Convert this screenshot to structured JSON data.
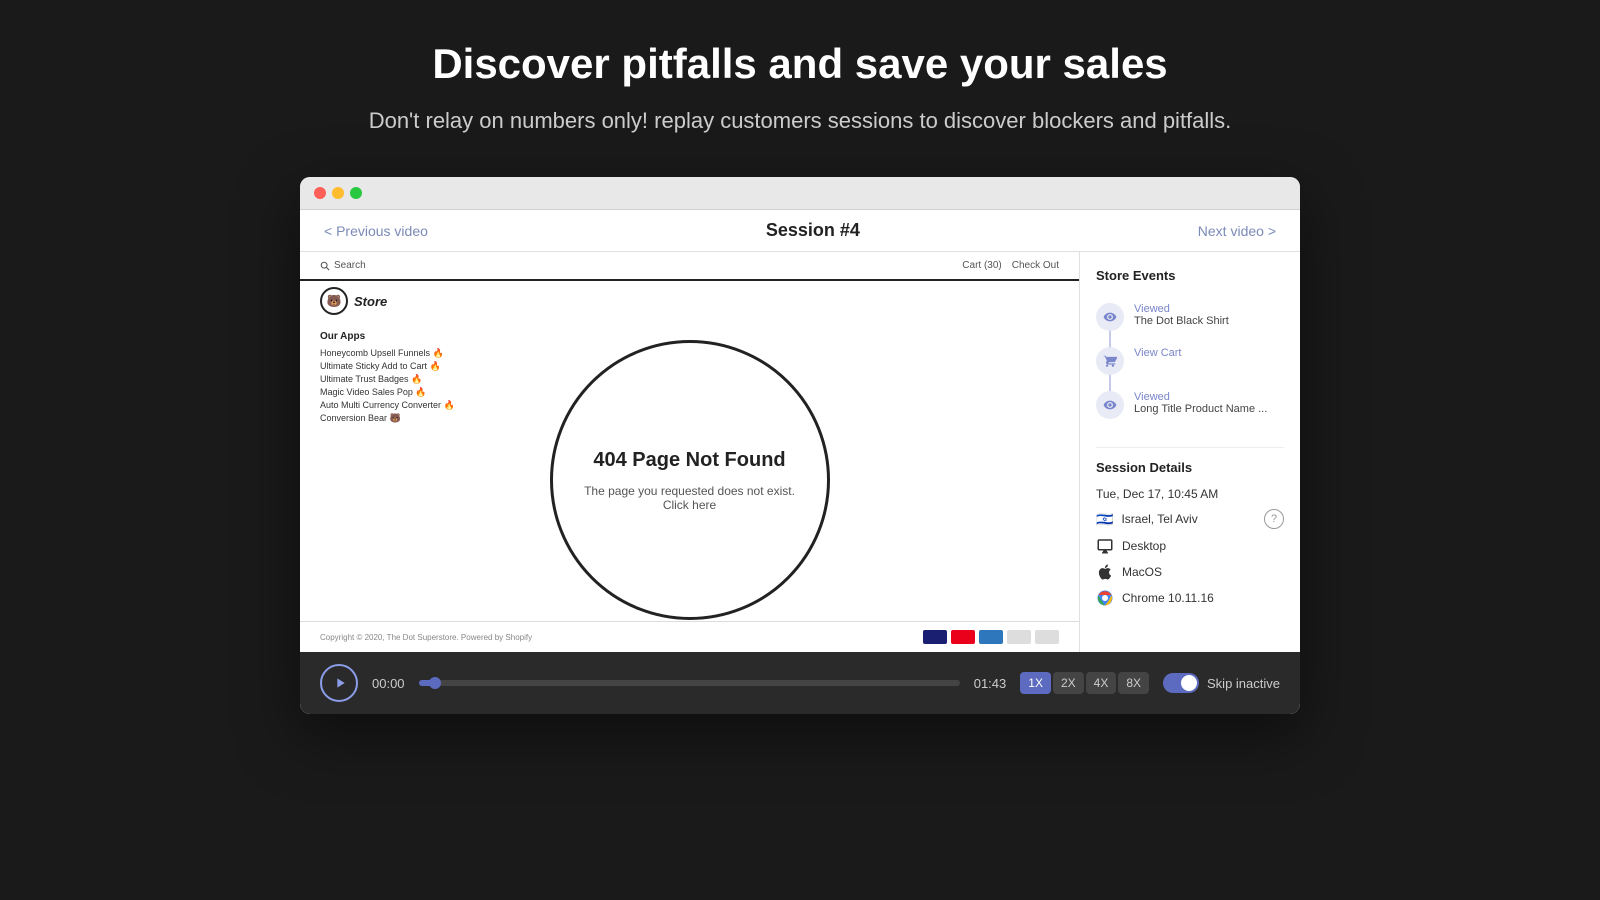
{
  "page": {
    "title": "Discover pitfalls and save your sales",
    "subtitle": "Don't relay on numbers only! replay customers sessions to discover blockers and pitfalls."
  },
  "browser": {
    "session_nav": {
      "prev_label": "< Previous video",
      "session_label": "Session #4",
      "next_label": "Next video >"
    },
    "store": {
      "search_placeholder": "Search",
      "cart_label": "Cart (30)",
      "checkout_label": "Check Out",
      "logo_text": "Store",
      "error_title": "404 Page Not Found",
      "error_body": "The page you requested does not exist. Click here",
      "apps_title": "Our Apps",
      "apps": [
        "Honeycomb Upsell Funnels 🔥",
        "Ultimate Sticky Add to Cart 🔥",
        "Ultimate Trust Badges 🔥",
        "Magic Video Sales Pop 🔥",
        "Auto Multi Currency Converter 🔥",
        "Conversion Bear 🐻"
      ],
      "footer_copy": "Copyright © 2020, The Dot Superstore. Powered by Shopify"
    },
    "sidebar": {
      "events_title": "Store Events",
      "events": [
        {
          "label": "Viewed",
          "detail": "The Dot Black Shirt",
          "type": "eye"
        },
        {
          "label": "View Cart",
          "detail": "",
          "type": "cart"
        },
        {
          "label": "Viewed",
          "detail": "Long Title Product Name ...",
          "type": "eye"
        }
      ],
      "details_title": "Session Details",
      "date": "Tue, Dec 17, 10:45 AM",
      "location": "Israel, Tel Aviv",
      "device": "Desktop",
      "os": "MacOS",
      "browser": "Chrome 10.11.16"
    },
    "controls": {
      "time_current": "00:00",
      "time_end": "01:43",
      "speeds": [
        "1X",
        "2X",
        "4X",
        "8X"
      ],
      "active_speed": "1X",
      "skip_label": "Skip inactive"
    }
  }
}
